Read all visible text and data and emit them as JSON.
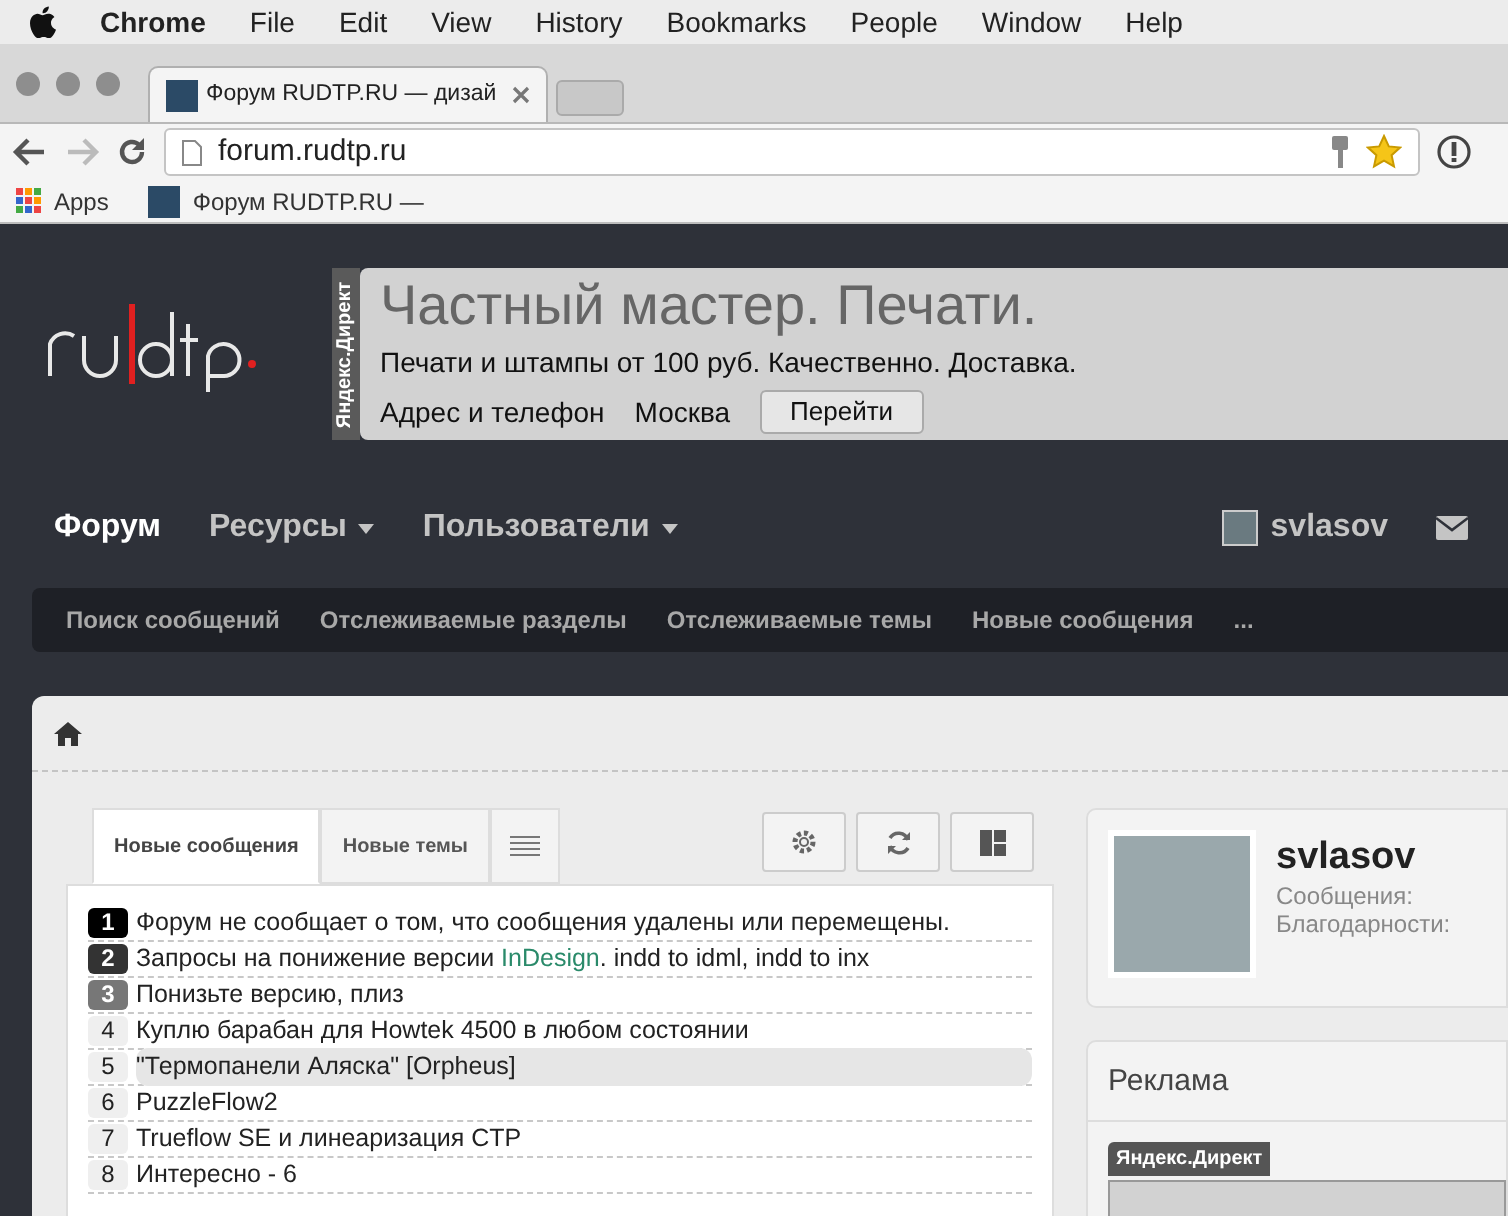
{
  "menu_bar": {
    "app": "Chrome",
    "items": [
      "File",
      "Edit",
      "View",
      "History",
      "Bookmarks",
      "People",
      "Window",
      "Help"
    ]
  },
  "browser": {
    "tab_title": "Форум RUDTP.RU — дизай",
    "url": "forum.rudtp.ru",
    "bookmarks": [
      {
        "kind": "apps",
        "label": "Apps"
      },
      {
        "kind": "site",
        "label": "Форум RUDTP.RU —"
      }
    ]
  },
  "ad_banner": {
    "label": "Яндекс.Директ",
    "title": "Частный мастер. Печати.",
    "text": "Печати и штампы от 100 руб. Качественно. Доставка.",
    "address": "Адрес и телефон",
    "city": "Москва",
    "button": "Перейти"
  },
  "nav": {
    "items": [
      {
        "label": "Форум",
        "selected": true,
        "dropdown": false
      },
      {
        "label": "Ресурсы",
        "selected": false,
        "dropdown": true
      },
      {
        "label": "Пользователи",
        "selected": false,
        "dropdown": true
      }
    ],
    "user": "svlasov"
  },
  "subnav": [
    "Поиск сообщений",
    "Отслеживаемые разделы",
    "Отслеживаемые темы",
    "Новые сообщения",
    "..."
  ],
  "widget": {
    "tabs": [
      {
        "label": "Новые сообщения",
        "selected": true
      },
      {
        "label": "Новые темы",
        "selected": false
      }
    ],
    "rows": [
      {
        "rank": "1",
        "highlighted": false,
        "parts": [
          {
            "kind": "plain",
            "text": "Форум не сообщает о том, что сообщения удалены или перемещены."
          }
        ]
      },
      {
        "rank": "2",
        "highlighted": false,
        "parts": [
          {
            "kind": "plain",
            "text": "Запросы на понижение версии"
          },
          {
            "kind": "accent",
            "text": "InDesign"
          },
          {
            "kind": "plain",
            "text": ". indd to idml, indd to inx"
          }
        ]
      },
      {
        "rank": "3",
        "highlighted": false,
        "parts": [
          {
            "kind": "plain",
            "text": "Понизьте версию, плиз"
          }
        ]
      },
      {
        "rank": "4",
        "highlighted": false,
        "parts": [
          {
            "kind": "plain",
            "text": "Куплю барабан для Howtek 4500 в любом состоянии"
          }
        ]
      },
      {
        "rank": "5",
        "highlighted": true,
        "parts": [
          {
            "kind": "plain",
            "text": "\"Термопанели Аляска\" [Orpheus]"
          }
        ]
      },
      {
        "rank": "6",
        "highlighted": false,
        "parts": [
          {
            "kind": "plain",
            "text": "PuzzleFlow2"
          }
        ]
      },
      {
        "rank": "7",
        "highlighted": false,
        "parts": [
          {
            "kind": "plain",
            "text": "Trueflow SE и линеаризация CTP"
          }
        ]
      },
      {
        "rank": "8",
        "highlighted": false,
        "parts": [
          {
            "kind": "plain",
            "text": "Интересно - 6"
          }
        ]
      }
    ]
  },
  "profile": {
    "name": "svlasov",
    "stats": [
      "Сообщения:",
      "Благодарности:"
    ]
  },
  "sidebar_ad": {
    "heading": "Реклама",
    "label": "Яндекс.Директ"
  }
}
